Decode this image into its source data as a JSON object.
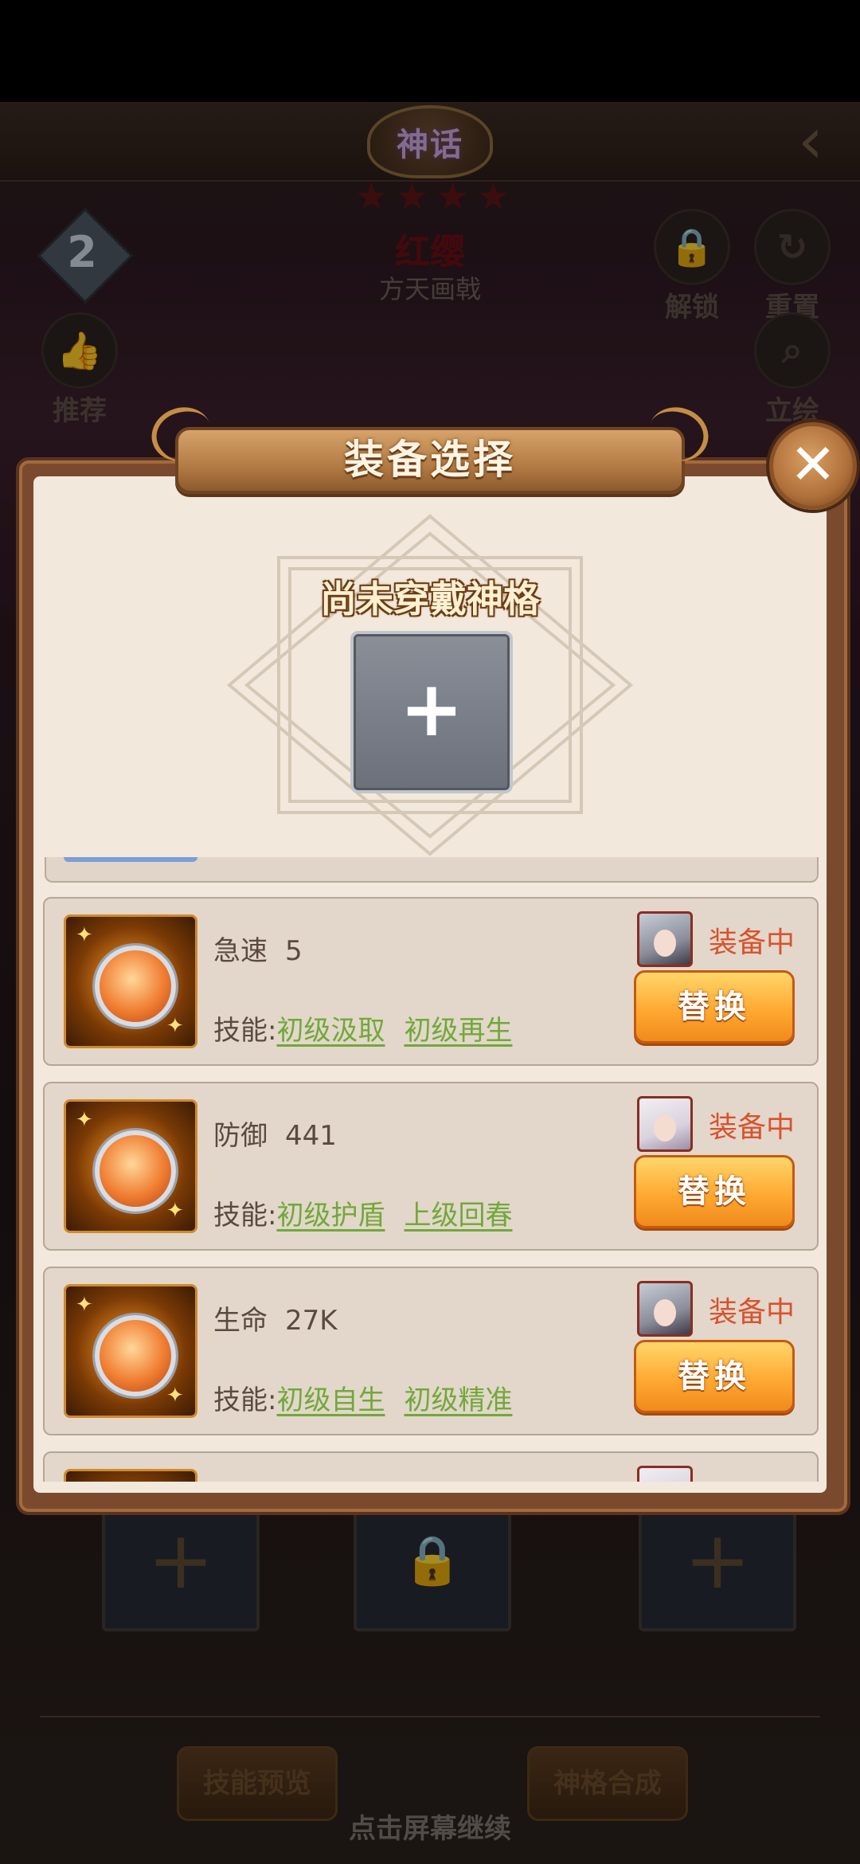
{
  "header": {
    "rank_label": "神话",
    "stars": [
      "★",
      "★",
      "★",
      "★"
    ],
    "hero_name": "红缨",
    "weapon_name": "方天画戟",
    "level_badge": "2"
  },
  "side_buttons": {
    "recommend": "推荐",
    "unlock": "解锁",
    "reset": "重置",
    "artwork": "立绘"
  },
  "modal": {
    "title": "装备选择",
    "close_glyph": "✕",
    "empty_label": "尚未穿戴神格",
    "add_glyph": "+"
  },
  "items": [
    {
      "stat_name": "急速",
      "stat_value": "5",
      "skill_prefix": "技能:",
      "skills": [
        "初级汲取",
        "初级再生"
      ],
      "status": "装备中",
      "action": "替换",
      "avatar": "silver-hair-male"
    },
    {
      "stat_name": "防御",
      "stat_value": "441",
      "skill_prefix": "技能:",
      "skills": [
        "初级护盾",
        "上级回春"
      ],
      "status": "装备中",
      "action": "替换",
      "avatar": "white-hair-female"
    },
    {
      "stat_name": "生命",
      "stat_value": "27K",
      "skill_prefix": "技能:",
      "skills": [
        "初级自生",
        "初级精准"
      ],
      "status": "装备中",
      "action": "替换",
      "avatar": "silver-hair-male"
    }
  ],
  "bottom": {
    "skill_preview": "技能预览",
    "synthesis": "神格合成",
    "continue_hint": "点击屏幕继续"
  },
  "colors": {
    "accent_orange": "#ffa932",
    "status_red": "#d8532e",
    "skill_green": "#72a83a",
    "modal_bg": "#f2e8dc"
  }
}
